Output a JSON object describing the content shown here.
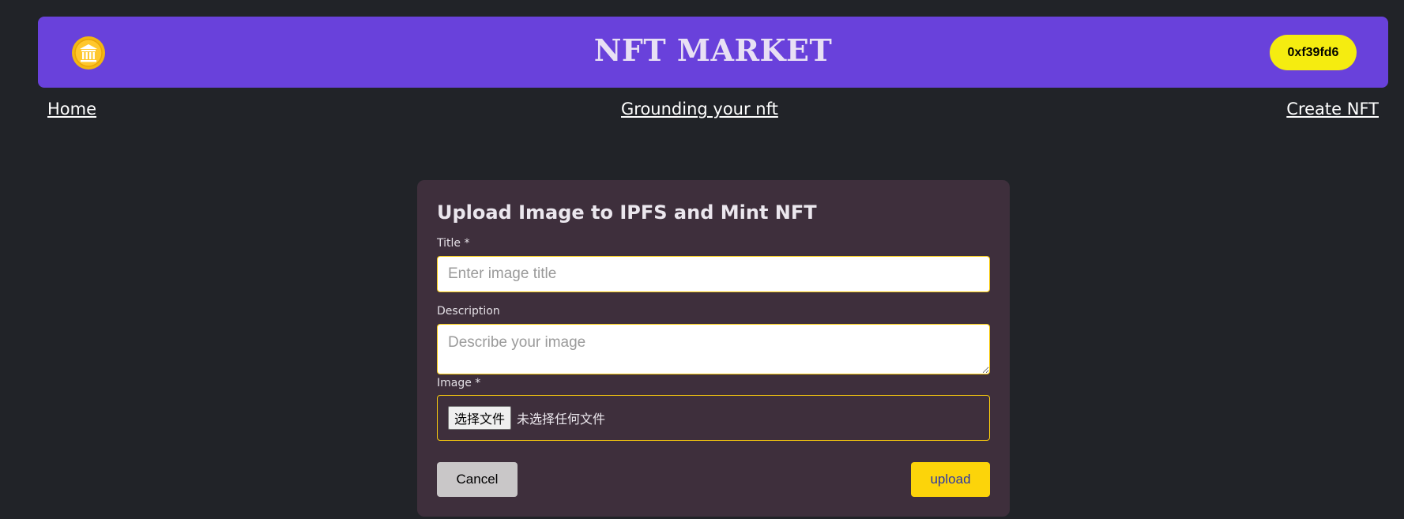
{
  "header": {
    "title": "NFT MARKET",
    "wallet_address": "0xf39fd6",
    "logo_icon": "bank-coin-icon"
  },
  "nav": {
    "home": "Home",
    "grounding": "Grounding your nft",
    "create": "Create NFT"
  },
  "form": {
    "heading": "Upload Image to IPFS and Mint NFT",
    "title_label": "Title *",
    "title_placeholder": "Enter image title",
    "description_label": "Description",
    "description_placeholder": "Describe your image",
    "image_label": "Image *",
    "file_button": "选择文件",
    "file_status": "未选择任何文件",
    "cancel_label": "Cancel",
    "upload_label": "upload"
  },
  "colors": {
    "background": "#212328",
    "header": "#6941db",
    "wallet": "#f5ec10",
    "card": "#3e2f3c",
    "accent": "#f6c90e"
  }
}
